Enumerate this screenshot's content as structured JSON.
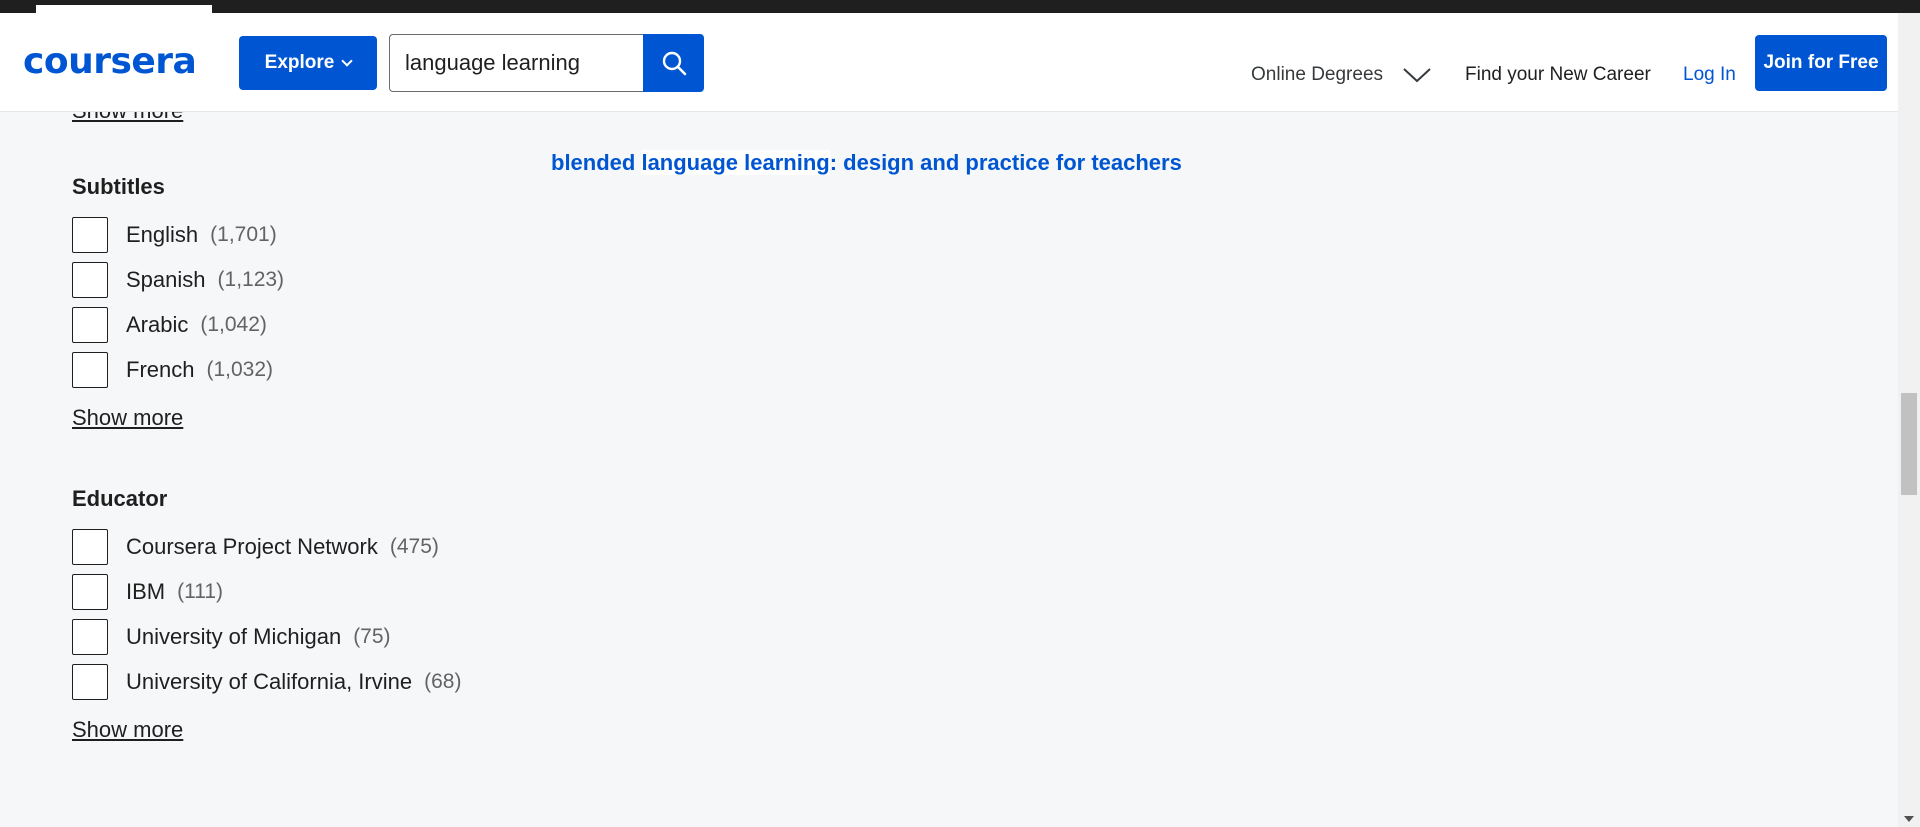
{
  "header": {
    "logo": "coursera",
    "explore_label": "Explore",
    "search_value": "language learning",
    "nav": {
      "online_degrees": "Online Degrees",
      "find_career": "Find your New Career",
      "login": "Log In",
      "join": "Join for Free"
    }
  },
  "filters": {
    "previous_show_more": "Show more",
    "subtitles": {
      "title": "Subtitles",
      "items": [
        {
          "label": "English",
          "count": "(1,701)"
        },
        {
          "label": "Spanish",
          "count": "(1,123)"
        },
        {
          "label": "Arabic",
          "count": "(1,042)"
        },
        {
          "label": "French",
          "count": "(1,032)"
        }
      ],
      "show_more": "Show more"
    },
    "educator": {
      "title": "Educator",
      "items": [
        {
          "label": "Coursera Project Network",
          "count": "(475)"
        },
        {
          "label": "IBM",
          "count": "(111)"
        },
        {
          "label": "University of Michigan",
          "count": "(75)"
        },
        {
          "label": "University of California, Irvine",
          "count": "(68)"
        }
      ],
      "show_more": "Show more"
    }
  },
  "results": {
    "suggestion": {
      "prefix": "blended ",
      "highlight": "language learning",
      "suffix": ": design and practice for teachers"
    }
  },
  "colors": {
    "brand_blue": "#0056d2",
    "background": "#f5f7f8",
    "text": "#1f1f1f",
    "muted": "#636363"
  }
}
